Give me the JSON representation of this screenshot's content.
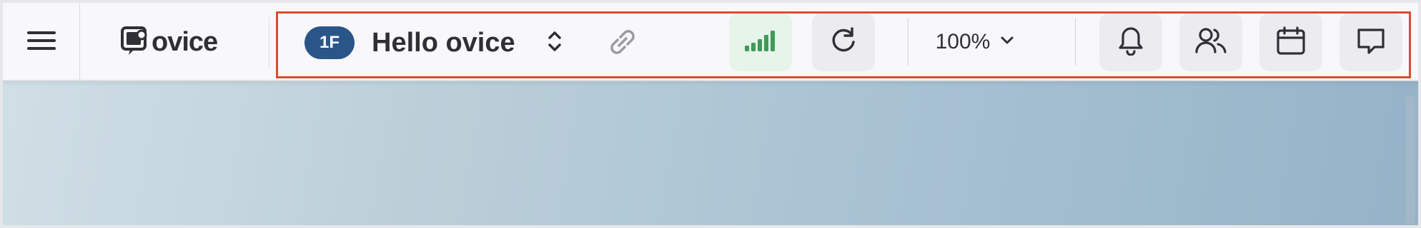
{
  "header": {
    "menu_icon": "hamburger-menu-icon",
    "logo": {
      "icon": "ovice-logo-icon",
      "text": "ovice"
    },
    "floor_badge": "1F",
    "space_name": "Hello ovice",
    "space_switch_icon": "chevron-up-down-icon",
    "copy_link_icon": "link-icon",
    "connection_icon": "signal-strength-icon",
    "reload_icon": "reload-icon",
    "zoom": {
      "value": "100%",
      "icon": "chevron-down-icon"
    },
    "notifications_icon": "bell-icon",
    "members_icon": "users-icon",
    "calendar_icon": "calendar-icon",
    "chat_icon": "chat-icon"
  },
  "colors": {
    "accent": "#2a5588",
    "signal": "#3f9b55",
    "highlight": "#e04a32"
  }
}
